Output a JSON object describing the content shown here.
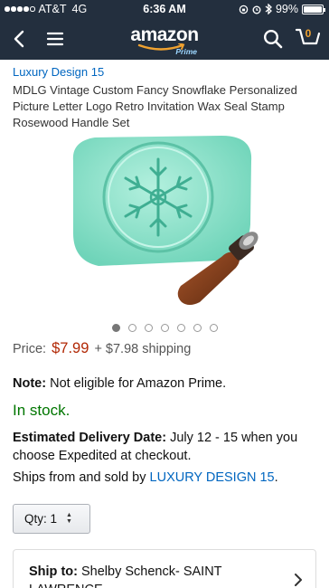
{
  "status_bar": {
    "carrier": "AT&T",
    "network": "4G",
    "time": "6:36 AM",
    "battery": "99%",
    "battery_level": 0.99
  },
  "nav": {
    "back_icon": "chevron-left-icon",
    "menu_icon": "hamburger-menu-icon",
    "logo_text": "amazon",
    "logo_sub": "Prime",
    "search_icon": "search-icon",
    "cart_icon": "cart-icon",
    "cart_count": "0"
  },
  "product": {
    "brand": "Luxury Design 15",
    "title": "MDLG Vintage Custom Fancy Snowflake Personalized Picture Letter Logo Retro Invitation Wax Seal Stamp Rosewood Handle Set",
    "image_count": 7,
    "active_image": 0,
    "price_label": "Price:",
    "price": "$7.99",
    "shipping": "+ $7.98 shipping",
    "note_label": "Note:",
    "note_text": "Not eligible for Amazon Prime.",
    "stock": "In stock.",
    "delivery_label": "Estimated Delivery Date:",
    "delivery_text": "July 12 - 15 when you choose Expedited at checkout.",
    "ships_text": "Ships from and sold by",
    "seller": "LUXURY DESIGN 15",
    "ships_end": "."
  },
  "qty": {
    "label": "Qty:",
    "value": "1"
  },
  "ship_to": {
    "label": "Ship to:",
    "text": "Shelby Schenck- SAINT LAWRENCE"
  },
  "colors": {
    "header_bg": "#232f3e",
    "link": "#0066c0",
    "price": "#b12704",
    "stock": "#007600",
    "wax": "#7fdcc4"
  }
}
